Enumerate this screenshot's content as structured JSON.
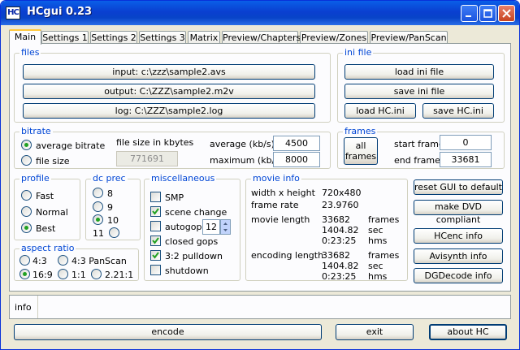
{
  "window": {
    "title": "HCgui 0.23",
    "icon_text": "HC"
  },
  "tabs": [
    "Main",
    "Settings 1",
    "Settings 2",
    "Settings 3",
    "Matrix",
    "Preview/Chapters",
    "Preview/Zones",
    "Preview/PanScan"
  ],
  "files": {
    "label": "files",
    "input": "input: c:\\zzz\\sample2.avs",
    "output": "output: C:\\ZZZ\\sample2.m2v",
    "log": "log: C:\\ZZZ\\sample2.log"
  },
  "ini_file": {
    "label": "ini file",
    "load": "load ini file",
    "save": "save ini file",
    "load_hc": "load HC.ini",
    "save_hc": "save HC.ini"
  },
  "bitrate": {
    "label": "bitrate",
    "options": [
      "average bitrate",
      "file size"
    ],
    "selected": "average bitrate",
    "file_size_label": "file size in kbytes",
    "file_size_value": "771691",
    "average_label": "average (kb/s)",
    "average_value": "4500",
    "maximum_label": "maximum (kb/s)",
    "maximum_value": "8000"
  },
  "frames": {
    "label": "frames",
    "all_frames_line1": "all",
    "all_frames_line2": "frames",
    "start_label": "start frame",
    "start_value": "0",
    "end_label": "end frame",
    "end_value": "33681"
  },
  "profile": {
    "label": "profile",
    "options": [
      "Fast",
      "Normal",
      "Best"
    ],
    "selected": "Best"
  },
  "dc_prec": {
    "label": "dc prec",
    "options": [
      "8",
      "9",
      "10",
      "11"
    ],
    "selected": "10"
  },
  "misc": {
    "label": "miscellaneous",
    "items": [
      {
        "label": "SMP",
        "checked": false
      },
      {
        "label": "scene change",
        "checked": true
      },
      {
        "label": "autogop",
        "checked": false
      },
      {
        "label": "closed gops",
        "checked": true
      },
      {
        "label": "3:2 pulldown",
        "checked": true
      },
      {
        "label": "shutdown",
        "checked": false
      }
    ],
    "autogop_value": "12"
  },
  "movie_info": {
    "label": "movie info",
    "width_height_label": "width x height",
    "width_height_value": "720x480",
    "frame_rate_label": "frame rate",
    "frame_rate_value": "23.9760",
    "movie_length_label": "movie length",
    "movie_length": [
      "33682",
      "1404.82",
      "0:23:25"
    ],
    "units": [
      "frames",
      "sec",
      "hms"
    ],
    "encoding_length_label": "encoding length",
    "encoding_length": [
      "33682",
      "1404.82",
      "0:23:25"
    ]
  },
  "aspect_ratio": {
    "label": "aspect ratio",
    "options": [
      "4:3",
      "4:3 PanScan",
      "16:9",
      "1:1",
      "2.21:1"
    ],
    "selected": "16:9"
  },
  "side_buttons": {
    "reset": "reset GUI to default",
    "dvd": "make DVD compliant",
    "hcenc": "HCenc info",
    "avisynth": "Avisynth info",
    "dgdecode": "DGDecode info"
  },
  "info": {
    "label": "info",
    "text": ""
  },
  "bottom": {
    "encode": "encode",
    "exit": "exit",
    "about": "about HC"
  }
}
